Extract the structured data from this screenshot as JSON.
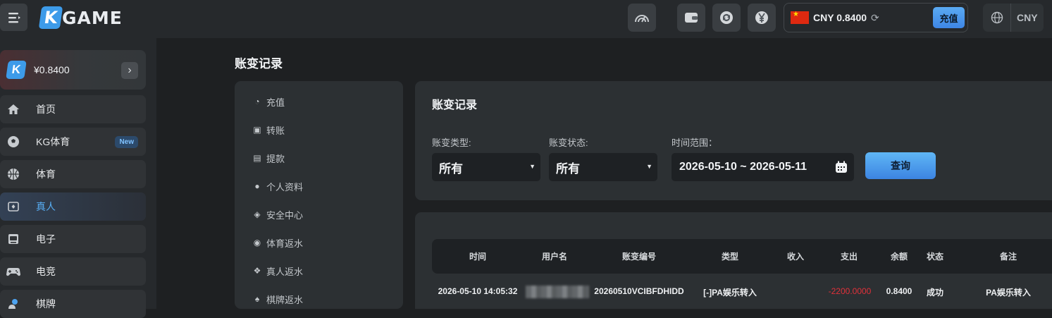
{
  "header": {
    "logo_k": "K",
    "logo_text": "GAME",
    "balance": "CNY 0.8400",
    "recharge_label": "充值",
    "currency": "CNY",
    "icons": [
      "speed-icon",
      "wallet-icon",
      "refresh-transfer-icon",
      "yuan-icon",
      "globe-icon"
    ]
  },
  "sidebar": {
    "wallet_amount": "¥0.8400",
    "items": [
      {
        "label": "首页",
        "icon": "home-icon"
      },
      {
        "label": "KG体育",
        "icon": "soccer-icon",
        "badge": "New"
      },
      {
        "label": "体育",
        "icon": "basketball-icon"
      },
      {
        "label": "真人",
        "icon": "cards-icon",
        "active": true
      },
      {
        "label": "电子",
        "icon": "slot-machine-icon"
      },
      {
        "label": "电竞",
        "icon": "gamepad-icon"
      },
      {
        "label": "棋牌",
        "icon": "chess-icon"
      }
    ]
  },
  "page": {
    "title": "账变记录"
  },
  "submenu": {
    "items": [
      {
        "label": "充值",
        "icon": "piggy-icon"
      },
      {
        "label": "转账",
        "icon": "transfer-icon"
      },
      {
        "label": "提款",
        "icon": "withdraw-icon"
      },
      {
        "label": "个人资料",
        "icon": "user-icon"
      },
      {
        "label": "安全中心",
        "icon": "shield-icon"
      },
      {
        "label": "体育返水",
        "icon": "ball-icon"
      },
      {
        "label": "真人返水",
        "icon": "chips-icon"
      },
      {
        "label": "棋牌返水",
        "icon": "spade-icon"
      }
    ]
  },
  "filters": {
    "title": "账变记录",
    "type_label": "账变类型:",
    "type_value": "所有",
    "status_label": "账变状态:",
    "status_value": "所有",
    "range_label": "时间范围：",
    "range_value": "2026-05-10 ~ 2026-05-11",
    "query_label": "查询"
  },
  "table": {
    "headers": [
      "时间",
      "用户名",
      "账变编号",
      "类型",
      "收入",
      "支出",
      "余额",
      "状态",
      "备注"
    ],
    "rows": [
      {
        "time": "2026-05-10 14:05:32",
        "username": "",
        "id": "20260510VCIBFDHIDD",
        "type": "[-]PA娱乐转入",
        "income": "",
        "expense": "-2200.0000",
        "balance": "0.8400",
        "status": "成功",
        "note": "PA娱乐转入"
      }
    ]
  },
  "colors": {
    "accent": "#3d9be9",
    "expense": "#e0303a",
    "active_nav": "#57adf3"
  }
}
